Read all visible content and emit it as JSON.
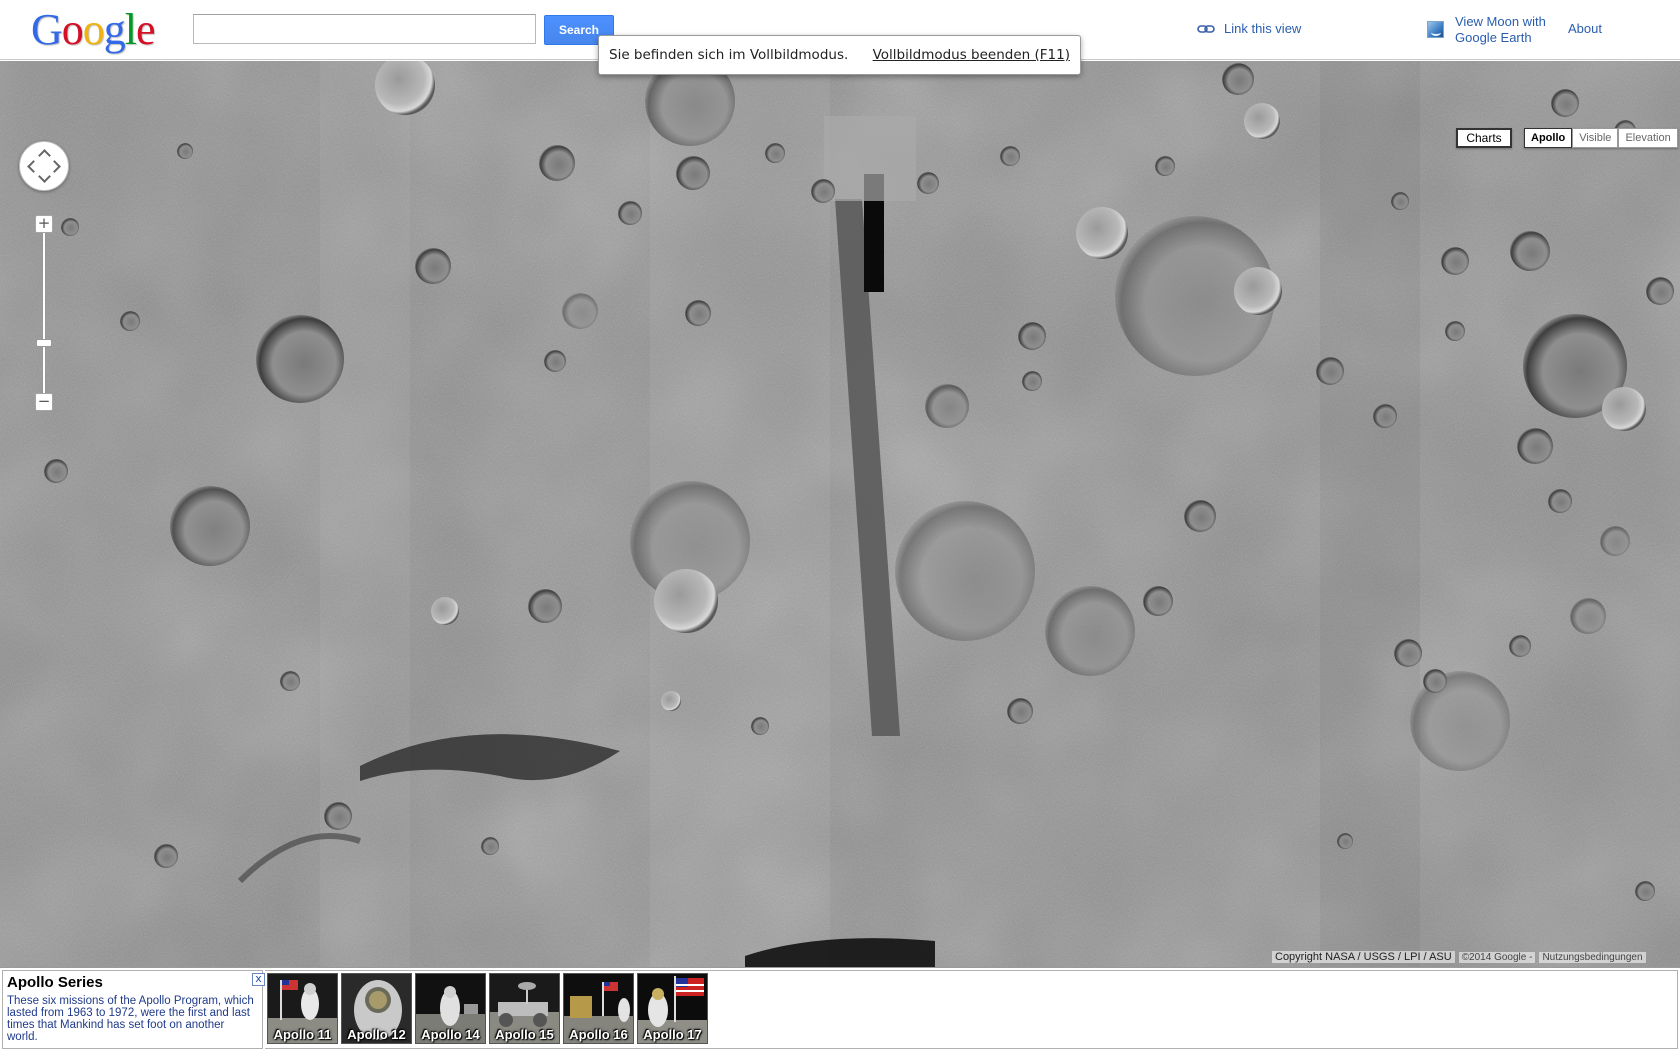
{
  "header": {
    "logo_letters": [
      "G",
      "o",
      "o",
      "g",
      "l",
      "e"
    ],
    "logo_colors": [
      "#3369e8",
      "#d50f25",
      "#eeb211",
      "#3369e8",
      "#009925",
      "#d50f25"
    ],
    "search_value": "",
    "search_label": "Search",
    "link_view": "Link this view",
    "earth_line1": "View Moon with",
    "earth_line2": "Google Earth",
    "about": "About"
  },
  "fullscreen": {
    "message": "Sie befinden sich im Vollbildmodus.",
    "exit": "Vollbildmodus beenden (F11)"
  },
  "map": {
    "zoom_in": "+",
    "zoom_out": "−",
    "charts": "Charts",
    "types": [
      {
        "label": "Apollo",
        "active": true
      },
      {
        "label": "Visible",
        "active": false
      },
      {
        "label": "Elevation",
        "active": false
      }
    ],
    "copyright": "Copyright NASA / USGS / LPI / ASU",
    "copyright_google": "©2014 Google -",
    "terms": "Nutzungsbedingungen"
  },
  "series": {
    "title": "Apollo Series",
    "description": "These six missions of the Apollo Program, which lasted from 1963 to 1972, were the first and last times that Mankind has set foot on another world.",
    "close": "x",
    "missions": [
      "Apollo 11",
      "Apollo 12",
      "Apollo 14",
      "Apollo 15",
      "Apollo 16",
      "Apollo 17"
    ]
  },
  "colors": {
    "accent": "#4d90fe",
    "link": "#2a5db0",
    "moon_base": "#8a8a8a"
  }
}
